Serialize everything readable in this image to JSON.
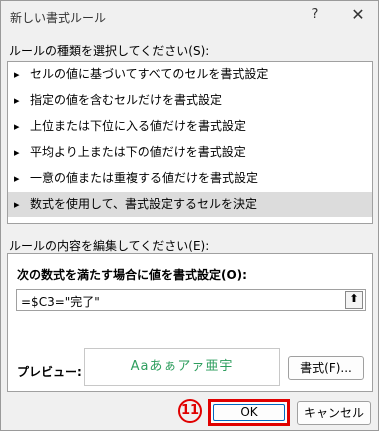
{
  "window": {
    "title": "新しい書式ルール",
    "help_glyph": "?",
    "close_glyph": "✕"
  },
  "rule_type": {
    "label": "ルールの種類を選択してください(S):",
    "arrow_glyph": "▸",
    "items": [
      "セルの値に基づいてすべてのセルを書式設定",
      "指定の値を含むセルだけを書式設定",
      "上位または下位に入る値だけを書式設定",
      "平均より上または下の値だけを書式設定",
      "一意の値または重複する値だけを書式設定",
      "数式を使用して、書式設定するセルを決定"
    ],
    "selected_index": 5
  },
  "rule_edit": {
    "label": "ルールの内容を編集してください(E):",
    "formula_label": "次の数式を満たす場合に値を書式設定(O):",
    "formula_value": "=$C3=\"完了\"",
    "collapse_glyph": "⬆",
    "preview_label": "プレビュー:",
    "preview_text": "Aaあぁアァ亜宇",
    "format_button": "書式(F)..."
  },
  "footer": {
    "ok_label": "OK",
    "cancel_label": "キャンセル",
    "step_badge": "11"
  },
  "colors": {
    "highlight_border": "#e00000",
    "preview_text": "#2e9e5e",
    "selected_row": "#dcdcdc"
  }
}
